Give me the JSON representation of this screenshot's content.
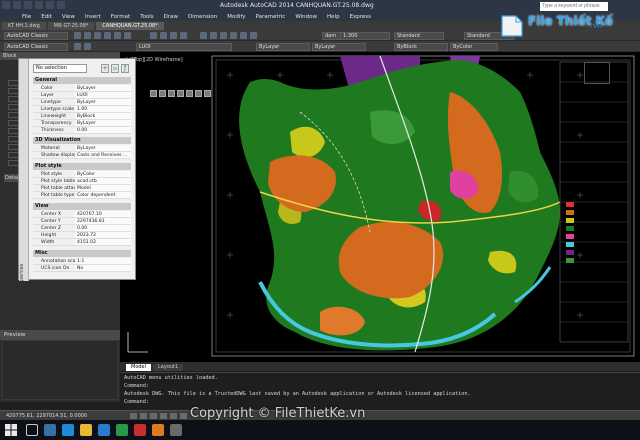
{
  "window": {
    "title": "Autodesk AutoCAD 2014    CANHQUAN.GT.25.08.dwg",
    "search_placeholder": "Type a keyword or phrase"
  },
  "menu": [
    "File",
    "Edit",
    "View",
    "Insert",
    "Format",
    "Tools",
    "Draw",
    "Dimension",
    "Modify",
    "Parametric",
    "Window",
    "Help",
    "Express"
  ],
  "file_tabs": [
    {
      "label": "KT HH.1.dwg"
    },
    {
      "label": "MB-GT-25.08*"
    },
    {
      "label": "CANHQUAN.GT.25.08*",
      "active": true
    }
  ],
  "toolbar": {
    "workspace": "AutoCAD Classic",
    "layer": "LUOI",
    "layer_color": "ByLayer",
    "layer_linetype": "ByLayer",
    "dim_style": "dam",
    "scale": "1:300",
    "text_style": "Standard",
    "color": "ByBlock",
    "table_style": "ByColor",
    "multileader_style": "Standard"
  },
  "dock": {
    "title": "Block",
    "section2": "Details",
    "preview_label": "Preview"
  },
  "properties": {
    "panel_label": "Properties",
    "selection": "No selection",
    "general_header": "General",
    "general": [
      {
        "k": "Color",
        "v": "ByLayer"
      },
      {
        "k": "Layer",
        "v": "LUOI"
      },
      {
        "k": "Linetype",
        "v": "ByLayer"
      },
      {
        "k": "Linetype scale",
        "v": "1.00"
      },
      {
        "k": "Lineweight",
        "v": "ByBlock"
      },
      {
        "k": "Transparency",
        "v": "ByLayer"
      },
      {
        "k": "Thickness",
        "v": "0.00"
      }
    ],
    "viz_header": "3D Visualization",
    "viz": [
      {
        "k": "Material",
        "v": "ByLayer"
      },
      {
        "k": "Shadow display",
        "v": "Casts and Receives ..."
      }
    ],
    "plot_header": "Plot style",
    "plot": [
      {
        "k": "Plot style",
        "v": "ByColor"
      },
      {
        "k": "Plot style table",
        "v": "acad.ctb"
      },
      {
        "k": "Plot table attac...",
        "v": "Model"
      },
      {
        "k": "Plot table type",
        "v": "Color dependent"
      }
    ],
    "view_header": "View",
    "view": [
      {
        "k": "Center X",
        "v": "420767.10"
      },
      {
        "k": "Center Y",
        "v": "2297436.81"
      },
      {
        "k": "Center Z",
        "v": "0.00"
      },
      {
        "k": "Height",
        "v": "2023.72"
      },
      {
        "k": "Width",
        "v": "4151.02"
      }
    ],
    "misc_header": "Misc",
    "misc": [
      {
        "k": "Annotation scale",
        "v": "1:1"
      },
      {
        "k": "UCS icon On",
        "v": "No"
      }
    ]
  },
  "viewport": {
    "label": "[-][Top][2D Wireframe]"
  },
  "layout_tabs": [
    "Model",
    "Layout1"
  ],
  "command": {
    "lines": [
      "AutoCAD menu utilities loaded.",
      "Command:",
      "Autodesk DWG.  This file is a TrustedDWG last saved by an Autodesk application or Autodesk licensed application.",
      "Command:"
    ]
  },
  "status": {
    "coords": "420775.61, 2297014.51, 0.0000"
  },
  "watermark": "Copyright © FileThietKe.vn",
  "logo": {
    "main": "File Thiết Kế",
    "sub": ".vn"
  },
  "colors": {
    "ui_dark": "#2c3644",
    "canvas": "#000000",
    "map_green": "#1f7a1f",
    "map_orange": "#d46a1e",
    "map_purple": "#6b2a8a",
    "map_cyan": "#46c8e0"
  }
}
